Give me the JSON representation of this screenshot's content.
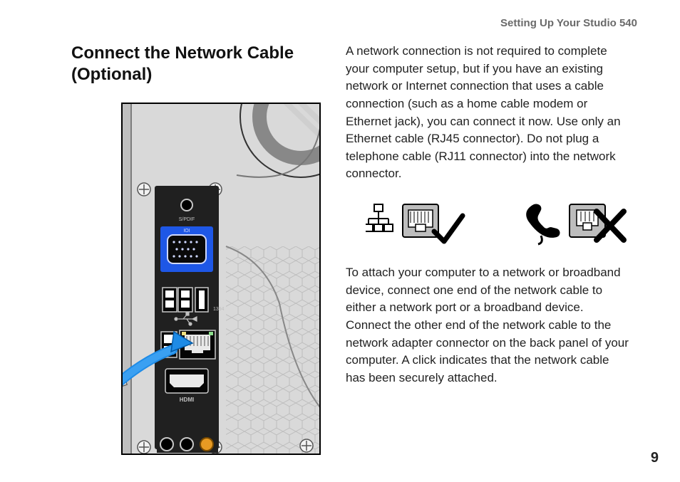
{
  "running_head": "Setting Up Your Studio 540",
  "section_title": "Connect the Network Cable (Optional)",
  "paragraph1": "A network connection is not required to complete your computer setup, but if you have an existing network or Internet connection that uses a cable connection (such as a home cable modem or Ethernet jack), you can connect it now. Use only an Ethernet cable (RJ45 connector). Do not plug a telephone cable (RJ11 connector) into the network connector.",
  "paragraph2": "To attach your computer to a network or broadband device, connect one end of the network cable to either a network port or a broadband device. Connect the other end of the network cable to the network adapter connector on the back panel of your computer. A click indicates that the network cable has been securely attached.",
  "page_number": "9",
  "icons": {
    "ethernet_ok": "ethernet-rj45-ok",
    "phone_no": "phone-rj11-no"
  }
}
